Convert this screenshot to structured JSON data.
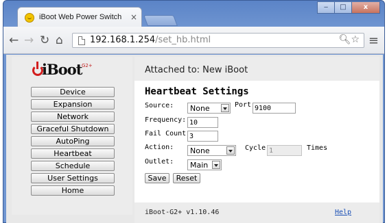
{
  "browser": {
    "tab_title": "iBoot Web Power Switch",
    "tab_close": "×",
    "url_host": "192.168.1.254",
    "url_path": "/set_hb.html",
    "window_buttons": [
      "‒",
      "□",
      "x"
    ]
  },
  "logo": {
    "text": "iBoot",
    "superscript": "G2+"
  },
  "sidebar": {
    "items": [
      {
        "label": "Device"
      },
      {
        "label": "Expansion"
      },
      {
        "label": "Network"
      },
      {
        "label": "Graceful Shutdown"
      },
      {
        "label": "AutoPing"
      },
      {
        "label": "Heartbeat"
      },
      {
        "label": "Schedule"
      },
      {
        "label": "User Settings"
      },
      {
        "label": "Home"
      }
    ]
  },
  "header": {
    "attached": "Attached to: New iBoot"
  },
  "form": {
    "heading": "Heartbeat Settings",
    "source_label": "Source:",
    "source_value": "None",
    "port_label": "Port",
    "port_value": "9100",
    "frequency_label": "Frequency:",
    "frequency_value": "10",
    "failcount_label": "Fail Count:",
    "failcount_value": "3",
    "action_label": "Action:",
    "action_value": "None",
    "cycle_label": "Cycle",
    "cycle_value": "1",
    "times_label": "Times",
    "outlet_label": "Outlet:",
    "outlet_value": "Main",
    "save_label": "Save",
    "reset_label": "Reset"
  },
  "footer": {
    "version": "iBoot-G2+ v1.10.46",
    "help": "Help"
  }
}
